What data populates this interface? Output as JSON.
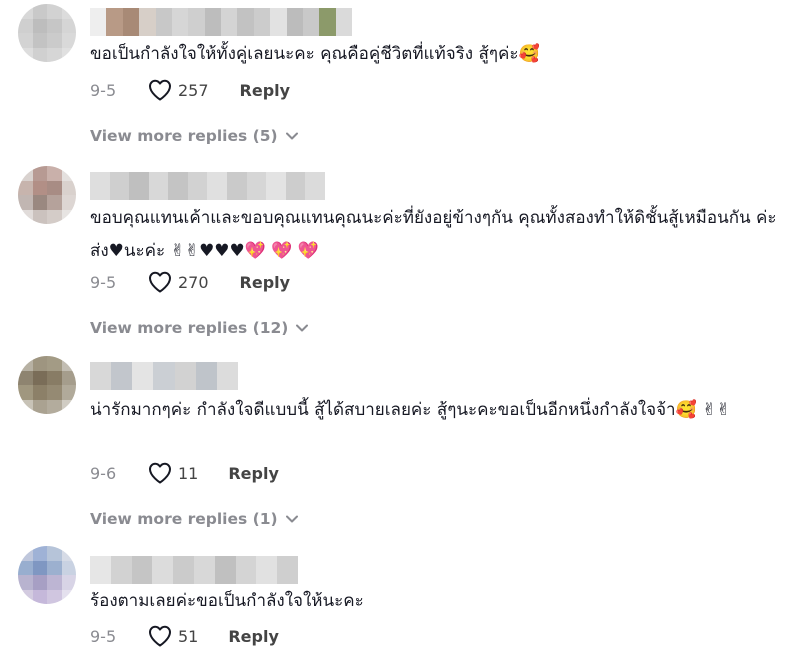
{
  "colors": {
    "text": "#161823",
    "muted": "#8a8b91",
    "background": "#ffffff"
  },
  "icons": {
    "like": "heart-outline-icon",
    "expand": "chevron-down-icon"
  },
  "comments": [
    {
      "text": "ขอเป็นกำลังใจให้ทั้งคู่เลยนะคะ คุณคือคู่ชีวิตที่แท้จริง สู้ๆค่ะ🥰",
      "date": "9-5",
      "likes": "257",
      "reply_label": "Reply",
      "view_more": "View more replies (5)"
    },
    {
      "text": "ขอบคุณแทนเค้าและขอบคุณแทนคุณนะค่ะที่ยังอยู่ข้างๆกัน คุณทั้งสองทำให้ดิชั้นสู้เหมือนกัน ค่ะ ส่ง♥นะค่ะ ✌✌♥♥♥💖 💖 💖",
      "date": "9-5",
      "likes": "270",
      "reply_label": "Reply",
      "view_more": "View more replies (12)"
    },
    {
      "text": "น่ารักมากๆค่ะ กำลังใจดีแบบนี้ สู้ได้สบายเลยค่ะ สู้ๆนะคะขอเป็นอีกหนึ่งกำลังใจจ้า🥰 ✌✌",
      "date": "9-6",
      "likes": "11",
      "reply_label": "Reply",
      "view_more": "View more replies (1)"
    },
    {
      "text": "ร้องตามเลยค่ะขอเป็นกำลังใจให้นะคะ",
      "date": "9-5",
      "likes": "51",
      "reply_label": "Reply"
    }
  ]
}
